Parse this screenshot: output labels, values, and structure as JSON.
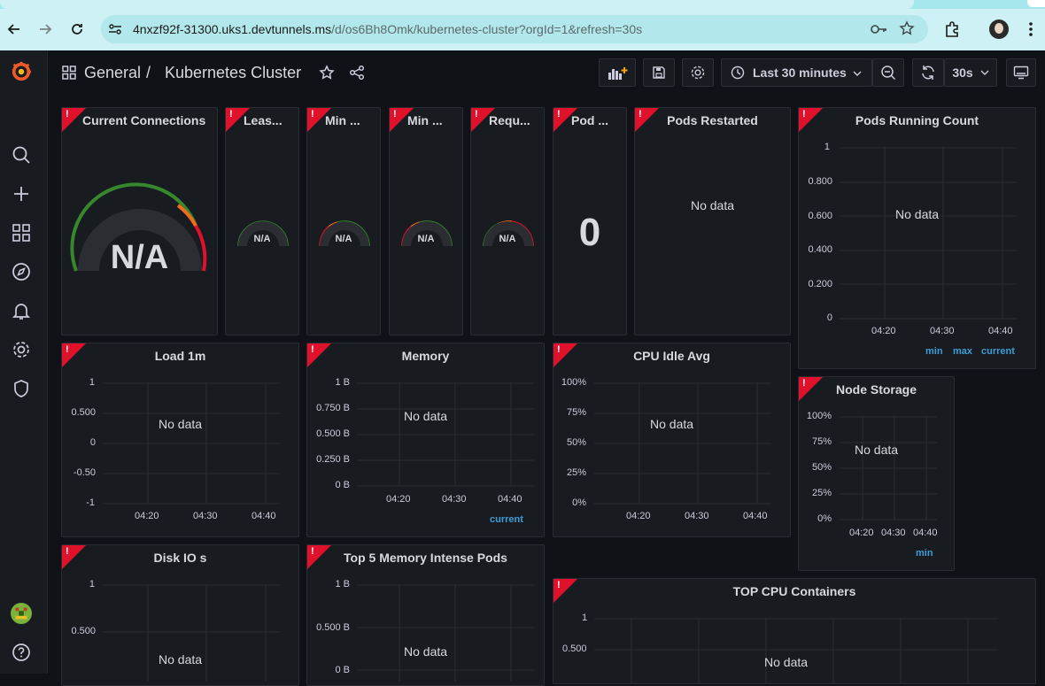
{
  "browser": {
    "url_host": "4nxzf92f-31300.uks1.devtunnels.ms",
    "url_path": "/d/os6Bh8Omk/kubernetes-cluster?orgId=1&refresh=30s"
  },
  "breadcrumb": {
    "root": "General",
    "separator": "/",
    "title": "Kubernetes Cluster"
  },
  "toolbar": {
    "time_range": "Last 30 minutes",
    "refresh_interval": "30s"
  },
  "colors": {
    "error": "#e0112b",
    "gauge_green": "#37872d",
    "gauge_red": "#e0112b",
    "legend_blue": "#3d9dd9",
    "grafana_orange": "#f05a28"
  },
  "panels": {
    "current_connections": {
      "title": "Current Connections",
      "value": "N/A"
    },
    "lease": {
      "title": "Leas...",
      "value": "N/A"
    },
    "min1": {
      "title": "Min ...",
      "value": "N/A"
    },
    "min2": {
      "title": "Min ...",
      "value": "N/A"
    },
    "requ": {
      "title": "Requ...",
      "value": "N/A"
    },
    "pod": {
      "title": "Pod ...",
      "value": "0"
    },
    "pods_restarted": {
      "title": "Pods Restarted",
      "nodata": "No data"
    },
    "pods_running": {
      "title": "Pods Running Count",
      "nodata": "No data",
      "yticks": [
        "1",
        "0.800",
        "0.600",
        "0.400",
        "0.200",
        "0"
      ],
      "xticks": [
        "04:20",
        "04:30",
        "04:40"
      ],
      "legend": [
        "min",
        "max",
        "current"
      ]
    },
    "load1m": {
      "title": "Load 1m",
      "nodata": "No data",
      "yticks": [
        "1",
        "0.500",
        "0",
        "-0.50",
        "-1"
      ],
      "xticks": [
        "04:20",
        "04:30",
        "04:40"
      ]
    },
    "memory": {
      "title": "Memory",
      "nodata": "No data",
      "yticks": [
        "1 B",
        "0.750 B",
        "0.500 B",
        "0.250 B",
        "0 B"
      ],
      "xticks": [
        "04:20",
        "04:30",
        "04:40"
      ],
      "legend": [
        "current"
      ]
    },
    "cpu_idle": {
      "title": "CPU Idle Avg",
      "nodata": "No data",
      "yticks": [
        "100%",
        "75%",
        "50%",
        "25%",
        "0%"
      ],
      "xticks": [
        "04:20",
        "04:30",
        "04:40"
      ]
    },
    "node_storage": {
      "title": "Node Storage",
      "nodata": "No data",
      "yticks": [
        "100%",
        "75%",
        "50%",
        "25%",
        "0%"
      ],
      "xticks": [
        "04:20",
        "04:30",
        "04:40"
      ],
      "legend": [
        "min"
      ]
    },
    "disk_io": {
      "title": "Disk IO s",
      "nodata": "No data",
      "yticks": [
        "1",
        "0.500"
      ]
    },
    "top5_mem": {
      "title": "Top 5 Memory Intense Pods",
      "nodata": "No data",
      "yticks": [
        "1 B",
        "0.500 B",
        "0 B"
      ]
    },
    "top_cpu": {
      "title": "TOP CPU Containers",
      "nodata": "No data",
      "yticks": [
        "1",
        "0.500"
      ]
    }
  }
}
